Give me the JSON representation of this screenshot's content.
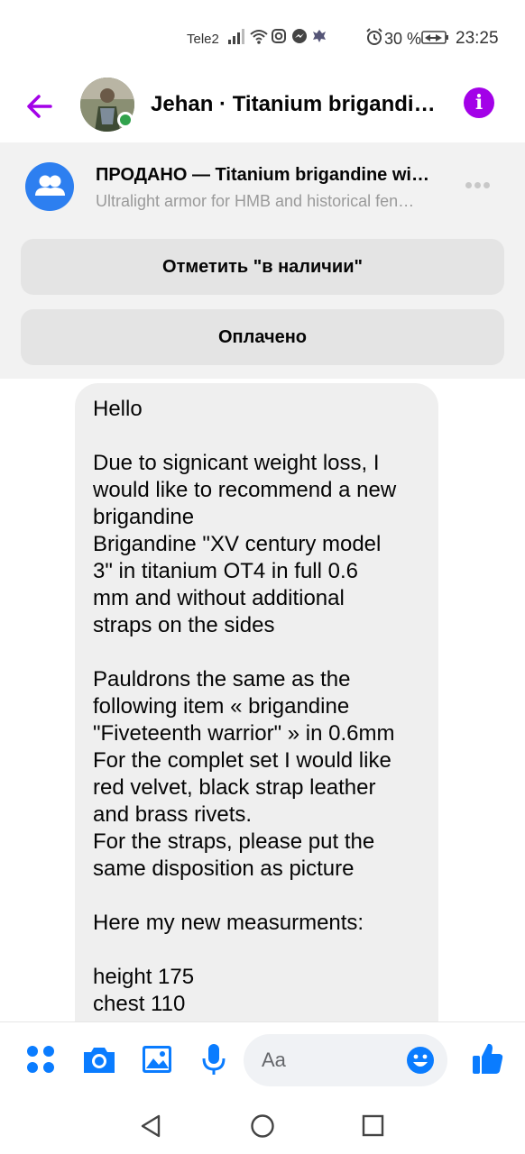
{
  "status_bar": {
    "carrier": "Tele2",
    "battery_percent": "30 %",
    "time": "23:25"
  },
  "header": {
    "title": "Jehan · Titanium brigandin…",
    "back_icon": "back-arrow-icon",
    "info_icon": "info-icon",
    "accent_color": "#a301e8",
    "online": true
  },
  "listing": {
    "title": "ПРОДАНО — Titanium brigandine wi…",
    "subtitle": "Ultralight armor for HMB and historical fen…",
    "mark_in_stock_label": "Отметить \"в наличии\"",
    "paid_label": "Оплачено"
  },
  "message": {
    "lines": [
      "Hello",
      "",
      "Due to signicant weight loss, I",
      "would like to recommend a new",
      "brigandine",
      "Brigandine \"XV century model",
      "3\" in titanium OT4 in full 0.6",
      "mm and without additional",
      "straps on the sides",
      "",
      "Pauldrons the same as the",
      "following item « brigandine",
      "\"Fiveteenth warrior\" » in 0.6mm",
      "For the complet set I would like",
      "red velvet, black strap leather",
      "and brass rivets.",
      "For the straps, please put the",
      "same disposition as picture",
      "",
      "Here my new measurments:",
      "",
      "height 175",
      "chest 110"
    ]
  },
  "composer": {
    "placeholder": "Aa",
    "accent_color": "#0a7cff"
  },
  "navbar": {
    "back_icon": "nav-back-icon",
    "home_icon": "nav-home-icon",
    "recents_icon": "nav-recents-icon"
  }
}
